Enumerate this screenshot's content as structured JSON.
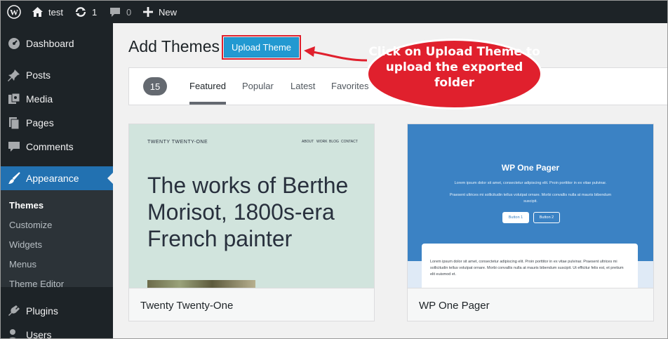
{
  "admin_bar": {
    "site_name": "test",
    "updates_count": "1",
    "comments_count": "0",
    "new_label": "New"
  },
  "sidebar": {
    "items": [
      {
        "label": "Dashboard",
        "icon": "dashboard-icon"
      },
      {
        "label": "Posts",
        "icon": "pin-icon"
      },
      {
        "label": "Media",
        "icon": "media-icon"
      },
      {
        "label": "Pages",
        "icon": "pages-icon"
      },
      {
        "label": "Comments",
        "icon": "comment-icon"
      },
      {
        "label": "Appearance",
        "icon": "brush-icon"
      },
      {
        "label": "Plugins",
        "icon": "plugin-icon"
      },
      {
        "label": "Users",
        "icon": "users-icon"
      }
    ],
    "submenu": [
      "Themes",
      "Customize",
      "Widgets",
      "Menus",
      "Theme Editor"
    ]
  },
  "page": {
    "title": "Add Themes",
    "upload_button": "Upload Theme"
  },
  "filter": {
    "count": "15",
    "tabs": [
      "Featured",
      "Popular",
      "Latest",
      "Favorites"
    ]
  },
  "themes": [
    {
      "name": "Twenty Twenty-One",
      "preview": {
        "brand": "TWENTY TWENTY-ONE",
        "nav": [
          "ABOUT",
          "WORK",
          "BLOG",
          "CONTACT"
        ],
        "headline": "The works of Berthe Morisot, 1800s-era French painter"
      }
    },
    {
      "name": "WP One Pager",
      "preview": {
        "heading": "WP One Pager",
        "para1": "Lorem ipsum dolor sit amet, consectetur adipiscing elit. Proin porttitor in ex vitae pulvinar.",
        "para2": "Praesent ultrices mi sollicitudin tellus volutpat ornare. Morbi convallis nulla at mauris bibendum suscipit.",
        "button1": "Button 1",
        "button2": "Button 2",
        "panel_text": "Lorem ipsum dolor sit amet, consectetur adipiscing elit. Proin porttitor in ex vitae pulvinar. Praesent ultrices mi sollicitudin tellus volutpat ornare. Morbi convallis nulla at mauris bibendum suscipit. Ut efficitur felis est, et pretium elit euismod et."
      }
    }
  ],
  "annotation": {
    "text": "Click on Upload Theme to upload the exported folder",
    "color": "#e0202d"
  },
  "colors": {
    "admin_bg": "#1d2327",
    "active": "#2271b1",
    "upload_button": "#2299d1"
  }
}
